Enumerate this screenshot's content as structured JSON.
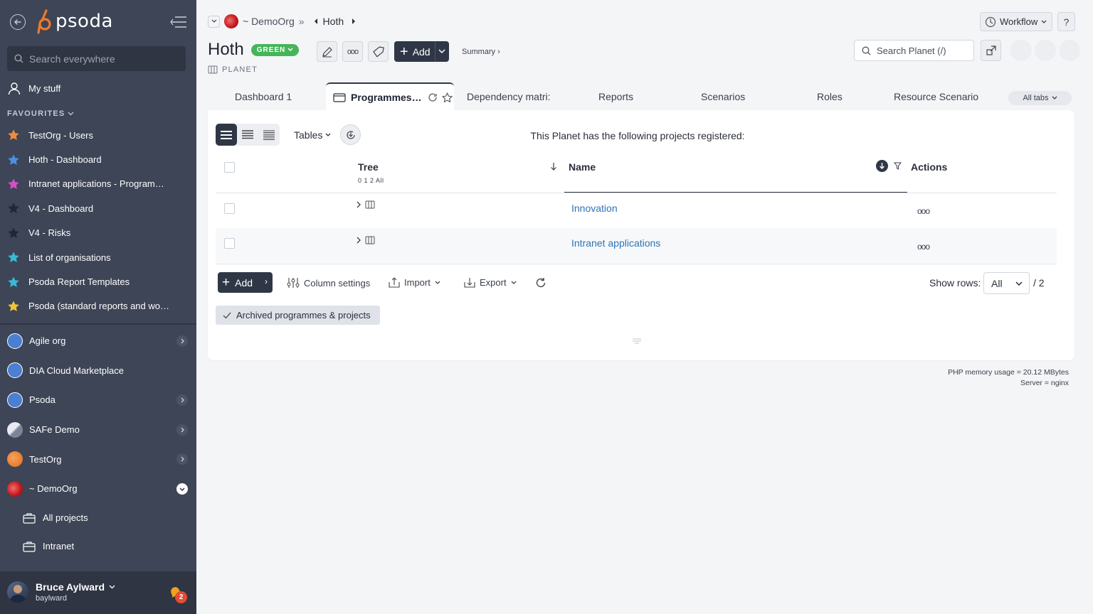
{
  "sidebar": {
    "logo": "psoda",
    "search_placeholder": "Search everywhere",
    "my_stuff": "My stuff",
    "favourites_label": "FAVOURITES",
    "favourites": [
      {
        "label": "TestOrg - Users",
        "color": "#f08c3a"
      },
      {
        "label": "Hoth - Dashboard",
        "color": "#4d8fe0"
      },
      {
        "label": "Intranet applications - Programme…",
        "color": "#d64fc4"
      },
      {
        "label": "V4 - Dashboard",
        "color": "#222733"
      },
      {
        "label": "V4 - Risks",
        "color": "#222733"
      },
      {
        "label": "List of organisations",
        "color": "#3ab8d6"
      },
      {
        "label": "Psoda Report Templates",
        "color": "#3ab8d6"
      },
      {
        "label": "Psoda (standard reports and work…",
        "color": "#f0c23a"
      }
    ],
    "orgs": [
      {
        "label": "Agile org",
        "has_chevron": true
      },
      {
        "label": "DIA Cloud Marketplace",
        "has_chevron": false
      },
      {
        "label": "Psoda",
        "has_chevron": true
      },
      {
        "label": "SAFe Demo",
        "has_chevron": true
      },
      {
        "label": "TestOrg",
        "has_chevron": true
      },
      {
        "label": "~ DemoOrg",
        "has_chevron": true,
        "expanded": true
      }
    ],
    "sub_items": [
      "All projects",
      "Intranet"
    ],
    "user": {
      "name": "Bruce Aylward",
      "login": "baylward",
      "notifications": "2"
    }
  },
  "breadcrumb": {
    "org": "~ DemoOrg",
    "sep": "»",
    "current": "Hoth"
  },
  "header": {
    "title": "Hoth",
    "status": "GREEN",
    "status_color": "#46b55a",
    "type": "PLANET",
    "add_label": "Add",
    "summary_link": "Summary ›",
    "workflow_label": "Workflow",
    "help_label": "?",
    "search_placeholder": "Search Planet (/)"
  },
  "tabs": [
    {
      "label": "Dashboard 1"
    },
    {
      "label": "Programmes…",
      "active": true
    },
    {
      "label": "Dependency matri:"
    },
    {
      "label": "Reports"
    },
    {
      "label": "Scenarios"
    },
    {
      "label": "Roles"
    },
    {
      "label": "Resource Scenario:"
    }
  ],
  "all_tabs_label": "All tabs",
  "panel": {
    "tables_label": "Tables",
    "info": "This Planet has the following projects registered:",
    "columns": {
      "tree": "Tree",
      "levels": "0 1 2 All",
      "name": "Name",
      "actions": "Actions"
    },
    "rows": [
      {
        "name": "Innovation",
        "actions": "ooo"
      },
      {
        "name": "Intranet applications",
        "actions": "ooo"
      }
    ],
    "footer": {
      "add_label": "Add",
      "column_settings": "Column settings",
      "import": "Import",
      "export": "Export",
      "show_rows_label": "Show rows:",
      "show_rows_value": "All",
      "total": "/ 2"
    },
    "archived_label": "Archived programmes & projects"
  },
  "server_info": {
    "memory": "PHP memory usage = 20.12 MBytes",
    "server": "Server = nginx"
  },
  "colors": {
    "sidebar_bg": "#3d4556",
    "primary_dark": "#2f3747",
    "link": "#2f74b5"
  }
}
